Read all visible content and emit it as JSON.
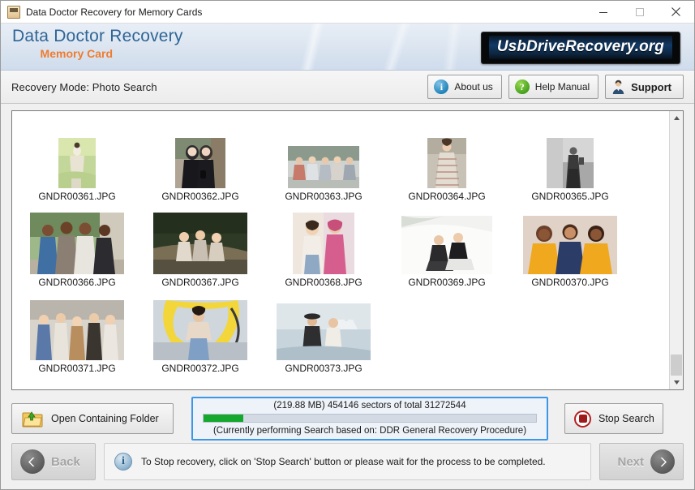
{
  "titlebar": {
    "title": "Data Doctor Recovery for Memory Cards",
    "minimize": "—",
    "maximize": "☐",
    "close": "✕",
    "app_icon": "memory-card-app-icon"
  },
  "banner": {
    "brand_main": "Data Doctor Recovery",
    "brand_sub": "Memory Card",
    "logo_text": "UsbDriveRecovery.org",
    "brand_main_color": "#2f6596",
    "brand_sub_color": "#ef7c2f"
  },
  "toolbar": {
    "mode_text": "Recovery Mode: Photo Search",
    "about_label": "About us",
    "about_icon": "i",
    "help_label": "Help Manual",
    "help_icon": "?",
    "support_label": "Support",
    "support_icon": "support-agent-icon"
  },
  "filepane": {
    "rows": [
      [
        {
          "label": "GNDR00361.JPG",
          "w": 46,
          "h": 62,
          "kind": "portrait-field-girl"
        },
        {
          "label": "GNDR00362.JPG",
          "w": 62,
          "h": 62,
          "kind": "two-women-black"
        },
        {
          "label": "GNDR00363.JPG",
          "w": 88,
          "h": 52,
          "kind": "group-street"
        },
        {
          "label": "GNDR00364.JPG",
          "w": 48,
          "h": 62,
          "kind": "woman-striped-dress"
        },
        {
          "label": "GNDR00365.JPG",
          "w": 58,
          "h": 62,
          "kind": "bw-couple"
        }
      ],
      [
        {
          "label": "GNDR00366.JPG",
          "w": 116,
          "h": 76,
          "kind": "four-friends"
        },
        {
          "label": "GNDR00367.JPG",
          "w": 116,
          "h": 76,
          "kind": "women-on-tree"
        },
        {
          "label": "GNDR00368.JPG",
          "w": 76,
          "h": 76,
          "kind": "two-women-pink"
        },
        {
          "label": "GNDR00369.JPG",
          "w": 112,
          "h": 72,
          "kind": "two-women-wall"
        },
        {
          "label": "GNDR00370.JPG",
          "w": 116,
          "h": 72,
          "kind": "three-women-yellow"
        }
      ],
      [
        {
          "label": "GNDR00371.JPG",
          "w": 116,
          "h": 74,
          "kind": "five-friends"
        },
        {
          "label": "GNDR00372.JPG",
          "w": 116,
          "h": 74,
          "kind": "woman-mural"
        },
        {
          "label": "GNDR00373.JPG",
          "w": 116,
          "h": 70,
          "kind": "couple-harbour"
        }
      ]
    ],
    "scroll": {
      "up_arrow": "▲",
      "down_arrow": "▼"
    }
  },
  "actions": {
    "open_folder_label": "Open Containing Folder",
    "open_folder_icon": "folder-up-arrow-icon",
    "stop_label": "Stop Search",
    "stop_icon": "stop-record-icon"
  },
  "progress": {
    "top_text": "(219.88 MB) 454146  sectors  of  total 31272544",
    "bottom_text": "(Currently performing Search based on:  DDR General Recovery Procedure)",
    "size_label": "219.88 MB",
    "sectors_done": 454146,
    "sectors_total": 31272544,
    "percent": 1.45,
    "fill_color": "#14a82e",
    "panel_border_color": "#3c97e8"
  },
  "footer": {
    "back_label": "Back",
    "back_icon": "chevron-left-icon",
    "next_label": "Next",
    "next_icon": "chevron-right-icon",
    "status_text": "To Stop recovery, click on 'Stop Search' button or please wait for the process to be completed.",
    "status_icon": "info-icon"
  }
}
